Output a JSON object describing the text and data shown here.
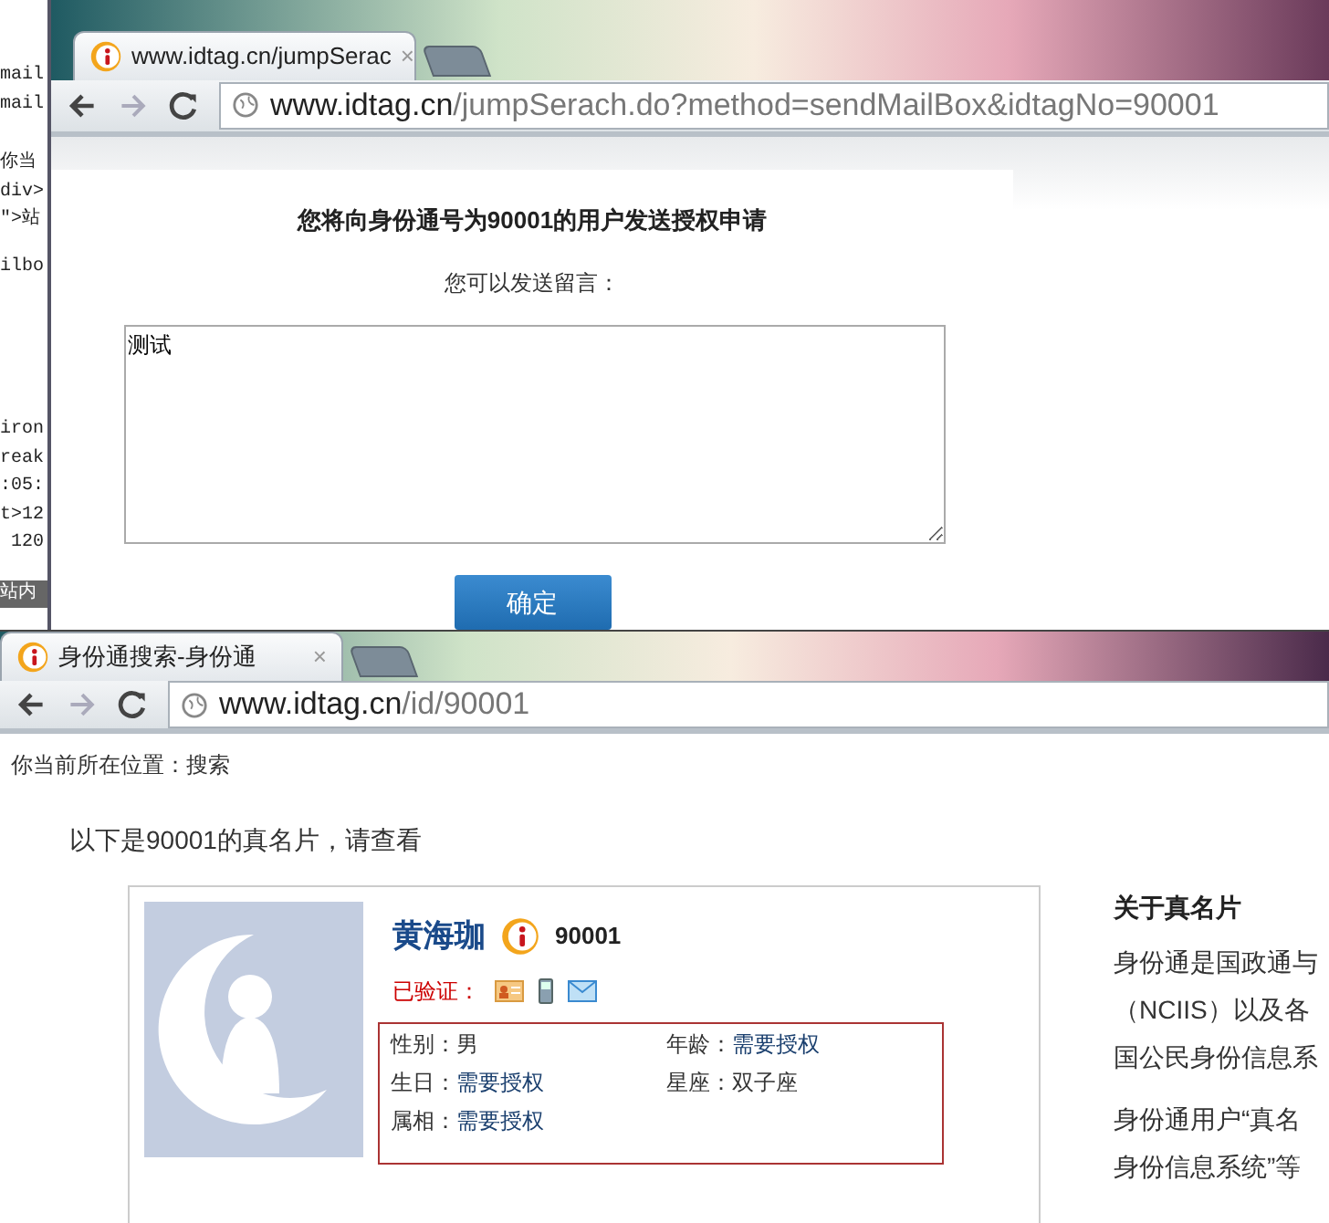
{
  "editor_blocks": [
    [
      "mail",
      "mail"
    ],
    [
      "你当",
      "div>",
      "\">站"
    ],
    [
      "ilbo"
    ],
    [
      "iron",
      "reak",
      ":05:",
      "t>12",
      " 120"
    ],
    [
      "站内"
    ]
  ],
  "top_window": {
    "tab": {
      "title": "www.idtag.cn/jumpSerac",
      "close": "×"
    },
    "address": {
      "host": "www.idtag.cn",
      "path": "/jumpSerach.do?method=sendMailBox&idtagNo=90001"
    },
    "heading": "您将向身份通号为90001的用户发送授权申请",
    "prompt": "您可以发送留言：",
    "message": "测试",
    "button": "确定"
  },
  "bottom_window": {
    "tab": {
      "title": "身份通搜索-身份通",
      "close": "×"
    },
    "address": {
      "host": "www.idtag.cn",
      "path": "/id/90001"
    },
    "breadcrumb": "你当前所在位置：搜索",
    "intro": "以下是90001的真名片，请查看",
    "card": {
      "name": "黄海珈",
      "id_number": "90001",
      "verified_label": "已验证：",
      "fields": [
        {
          "label": "性别：",
          "value": "男",
          "kind": "plain"
        },
        {
          "label": "年龄：",
          "value": "需要授权",
          "kind": "link"
        },
        {
          "label": "生日：",
          "value": "需要授权",
          "kind": "link"
        },
        {
          "label": "星座：",
          "value": "双子座",
          "kind": "plain"
        },
        {
          "label": "属相：",
          "value": "需要授权",
          "kind": "link"
        }
      ]
    },
    "about": {
      "title": "关于真名片",
      "paragraphs": [
        [
          "身份通是国政通与",
          "（NCIIS）以及各",
          "国公民身份信息系"
        ],
        [
          "身份通用户“真名",
          "身份信息系统”等"
        ]
      ]
    }
  }
}
